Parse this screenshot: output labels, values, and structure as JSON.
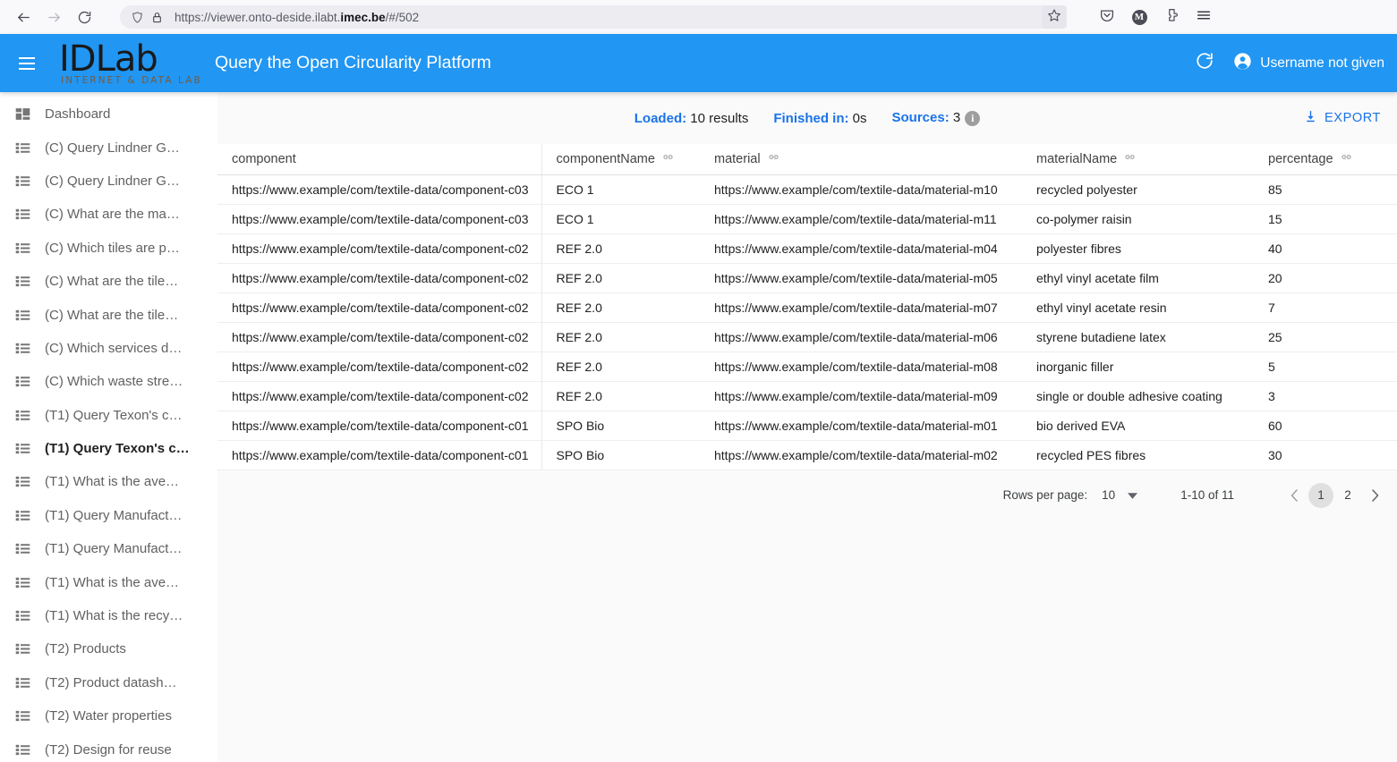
{
  "browser": {
    "url_prefix": "https://viewer.onto-deside.ilabt.",
    "url_bold": "imec.be",
    "url_suffix": "/#/502",
    "back_icon": "back-arrow-icon",
    "forward_icon": "forward-arrow-icon",
    "reload_icon": "reload-icon",
    "shield_icon": "shield-icon",
    "lock_icon": "lock-icon",
    "star_icon": "star-icon",
    "pocket_icon": "pocket-icon",
    "account_initial": "M",
    "extensions_icon": "extensions-icon",
    "menu_icon": "hamburger-menu-icon"
  },
  "header": {
    "menu_label": "menu",
    "logo_text": "IDLab",
    "logo_subtitle": "INTERNET & DATA LAB",
    "title": "Query the Open Circularity Platform",
    "refresh_label": "refresh",
    "username": "Username not given",
    "accent_color": "#2196f3"
  },
  "sidebar": {
    "items": [
      {
        "label": "Dashboard",
        "icon": "dashboard-icon",
        "active": false
      },
      {
        "label": "(C) Query Lindner G…",
        "icon": "list-icon",
        "active": false
      },
      {
        "label": "(C) Query Lindner G…",
        "icon": "list-icon",
        "active": false
      },
      {
        "label": "(C) What are the ma…",
        "icon": "list-icon",
        "active": false
      },
      {
        "label": "(C) Which tiles are p…",
        "icon": "list-icon",
        "active": false
      },
      {
        "label": "(C) What are the tile…",
        "icon": "list-icon",
        "active": false
      },
      {
        "label": "(C) What are the tile…",
        "icon": "list-icon",
        "active": false
      },
      {
        "label": "(C) Which services d…",
        "icon": "list-icon",
        "active": false
      },
      {
        "label": "(C) Which waste stre…",
        "icon": "list-icon",
        "active": false
      },
      {
        "label": "(T1) Query Texon's c…",
        "icon": "list-icon",
        "active": false
      },
      {
        "label": "(T1) Query Texon's c…",
        "icon": "list-icon",
        "active": true
      },
      {
        "label": "(T1) What is the ave…",
        "icon": "list-icon",
        "active": false
      },
      {
        "label": "(T1) Query Manufact…",
        "icon": "list-icon",
        "active": false
      },
      {
        "label": "(T1) Query Manufact…",
        "icon": "list-icon",
        "active": false
      },
      {
        "label": "(T1) What is the ave…",
        "icon": "list-icon",
        "active": false
      },
      {
        "label": "(T1) What is the recy…",
        "icon": "list-icon",
        "active": false
      },
      {
        "label": "(T2) Products",
        "icon": "list-icon",
        "active": false
      },
      {
        "label": "(T2) Product datash…",
        "icon": "list-icon",
        "active": false
      },
      {
        "label": "(T2) Water properties",
        "icon": "list-icon",
        "active": false
      },
      {
        "label": "(T2) Design for reuse",
        "icon": "list-icon",
        "active": false
      }
    ]
  },
  "status": {
    "loaded_label": "Loaded:",
    "loaded_value": "10 results",
    "finished_label": "Finished in:",
    "finished_value": "0s",
    "sources_label": "Sources:",
    "sources_value": "3",
    "info_glyph": "i",
    "export_label": "EXPORT",
    "export_icon": "download-icon",
    "link_color": "#1a73e8"
  },
  "table": {
    "columns": [
      {
        "key": "component",
        "label": "component",
        "has_link_icon": false
      },
      {
        "key": "componentName",
        "label": "componentName",
        "has_link_icon": true
      },
      {
        "key": "material",
        "label": "material",
        "has_link_icon": true
      },
      {
        "key": "materialName",
        "label": "materialName",
        "has_link_icon": true
      },
      {
        "key": "percentage",
        "label": "percentage",
        "has_link_icon": true
      }
    ],
    "rows": [
      {
        "component": "https://www.example/com/textile-data/component-c03",
        "componentName": "ECO 1",
        "material": "https://www.example/com/textile-data/material-m10",
        "materialName": "recycled polyester",
        "percentage": "85"
      },
      {
        "component": "https://www.example/com/textile-data/component-c03",
        "componentName": "ECO 1",
        "material": "https://www.example/com/textile-data/material-m11",
        "materialName": "co-polymer raisin",
        "percentage": "15"
      },
      {
        "component": "https://www.example/com/textile-data/component-c02",
        "componentName": "REF 2.0",
        "material": "https://www.example/com/textile-data/material-m04",
        "materialName": "polyester fibres",
        "percentage": "40"
      },
      {
        "component": "https://www.example/com/textile-data/component-c02",
        "componentName": "REF 2.0",
        "material": "https://www.example/com/textile-data/material-m05",
        "materialName": "ethyl vinyl acetate film",
        "percentage": "20"
      },
      {
        "component": "https://www.example/com/textile-data/component-c02",
        "componentName": "REF 2.0",
        "material": "https://www.example/com/textile-data/material-m07",
        "materialName": "ethyl vinyl acetate resin",
        "percentage": "7"
      },
      {
        "component": "https://www.example/com/textile-data/component-c02",
        "componentName": "REF 2.0",
        "material": "https://www.example/com/textile-data/material-m06",
        "materialName": "styrene butadiene latex",
        "percentage": "25"
      },
      {
        "component": "https://www.example/com/textile-data/component-c02",
        "componentName": "REF 2.0",
        "material": "https://www.example/com/textile-data/material-m08",
        "materialName": "inorganic filler",
        "percentage": "5"
      },
      {
        "component": "https://www.example/com/textile-data/component-c02",
        "componentName": "REF 2.0",
        "material": "https://www.example/com/textile-data/material-m09",
        "materialName": "single or double adhesive coating",
        "percentage": "3"
      },
      {
        "component": "https://www.example/com/textile-data/component-c01",
        "componentName": "SPO Bio",
        "material": "https://www.example/com/textile-data/material-m01",
        "materialName": "bio derived EVA",
        "percentage": "60"
      },
      {
        "component": "https://www.example/com/textile-data/component-c01",
        "componentName": "SPO Bio",
        "material": "https://www.example/com/textile-data/material-m02",
        "materialName": "recycled PES fibres",
        "percentage": "30"
      }
    ]
  },
  "paginator": {
    "rows_per_page_label": "Rows per page:",
    "rows_per_page_value": "10",
    "range_label": "1-10 of 11",
    "prev_label": "‹",
    "next_label": "›",
    "pages": [
      "1",
      "2"
    ],
    "current_page": "1"
  }
}
